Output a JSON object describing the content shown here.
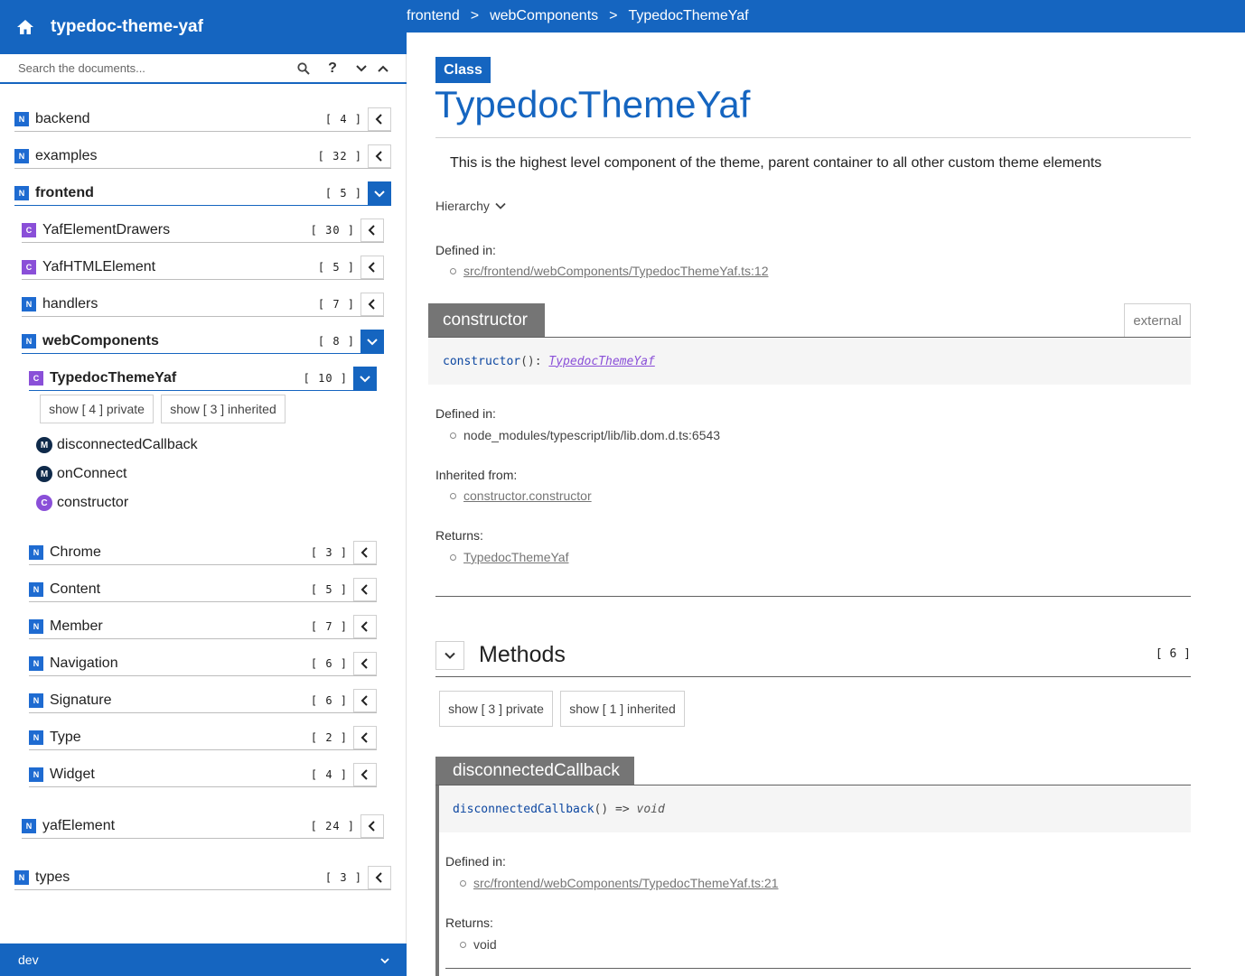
{
  "sidebar": {
    "title": "typedoc-theme-yaf",
    "search_placeholder": "Search the documents...",
    "help_label": "?",
    "footer_label": "dev",
    "items": [
      {
        "kind": "N",
        "label": "backend",
        "count": "[ 4 ]"
      },
      {
        "kind": "N",
        "label": "examples",
        "count": "[ 32 ]"
      },
      {
        "kind": "N",
        "label": "frontend",
        "count": "[ 5 ]"
      },
      {
        "kind": "C",
        "label": "YafElementDrawers",
        "count": "[ 30 ]"
      },
      {
        "kind": "C",
        "label": "YafHTMLElement",
        "count": "[ 5 ]"
      },
      {
        "kind": "N",
        "label": "handlers",
        "count": "[ 7 ]"
      },
      {
        "kind": "N",
        "label": "webComponents",
        "count": "[ 8 ]"
      },
      {
        "kind": "C",
        "label": "TypedocThemeYaf",
        "count": "[ 10 ]"
      },
      {
        "kind": "N",
        "label": "Chrome",
        "count": "[ 3 ]"
      },
      {
        "kind": "N",
        "label": "Content",
        "count": "[ 5 ]"
      },
      {
        "kind": "N",
        "label": "Member",
        "count": "[ 7 ]"
      },
      {
        "kind": "N",
        "label": "Navigation",
        "count": "[ 6 ]"
      },
      {
        "kind": "N",
        "label": "Signature",
        "count": "[ 6 ]"
      },
      {
        "kind": "N",
        "label": "Type",
        "count": "[ 2 ]"
      },
      {
        "kind": "N",
        "label": "Widget",
        "count": "[ 4 ]"
      },
      {
        "kind": "N",
        "label": "yafElement",
        "count": "[ 24 ]"
      },
      {
        "kind": "N",
        "label": "types",
        "count": "[ 3 ]"
      }
    ],
    "show_private": "show [ 4 ] private",
    "show_inherited": "show [ 3 ] inherited",
    "members": [
      {
        "kind": "M",
        "label": "disconnectedCallback"
      },
      {
        "kind": "M",
        "label": "onConnect"
      },
      {
        "kind": "C",
        "label": "constructor"
      }
    ]
  },
  "breadcrumb": [
    "frontend",
    "webComponents",
    "TypedocThemeYaf"
  ],
  "breadcrumb_sep": ">",
  "main": {
    "badge": "Class",
    "title": "TypedocThemeYaf",
    "description": "This is the highest level component of the theme, parent container to all other custom theme elements",
    "hierarchy_label": "Hierarchy",
    "defined_in_label": "Defined in:",
    "class_defined_in": "src/frontend/webComponents/TypedocThemeYaf.ts:12",
    "constructor": {
      "heading": "constructor",
      "tag": "external",
      "sig_name": "constructor",
      "sig_punc": "(): ",
      "sig_type": "TypedocThemeYaf",
      "defined_in_label": "Defined in:",
      "defined_in": "node_modules/typescript/lib/lib.dom.d.ts:6543",
      "inherited_label": "Inherited from:",
      "inherited_from": "constructor.constructor",
      "returns_label": "Returns:",
      "returns": "TypedocThemeYaf"
    },
    "methods": {
      "title": "Methods",
      "count": "[ 6 ]",
      "show_private": "show [ 3 ] private",
      "show_inherited": "show [ 1 ] inherited",
      "first": {
        "heading": "disconnectedCallback",
        "sig_name": "disconnectedCallback",
        "sig_punc": "() => ",
        "sig_type": "void",
        "defined_in_label": "Defined in:",
        "defined_in": "src/frontend/webComponents/TypedocThemeYaf.ts:21",
        "returns_label": "Returns:",
        "returns": "void"
      }
    }
  },
  "colors": {
    "primary": "#1565c0",
    "namespace": "#1e6bd1",
    "class": "#8a4fd8",
    "method": "#0f2a4a"
  }
}
